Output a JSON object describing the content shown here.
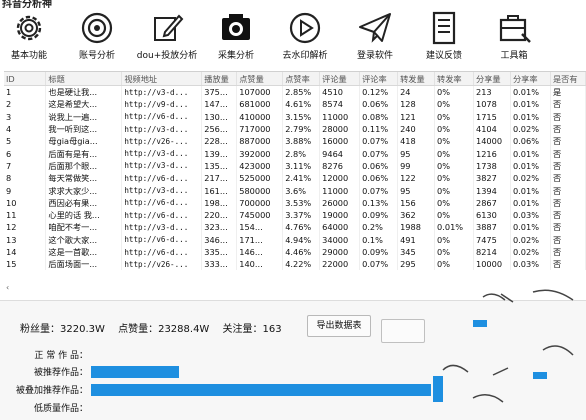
{
  "app": {
    "title": "抖音分析神"
  },
  "toolbar": [
    {
      "label": "基本功能",
      "icon": "gear-icon"
    },
    {
      "label": "账号分析",
      "icon": "target-icon"
    },
    {
      "label": "dou+投放分析",
      "icon": "pen-edit-icon"
    },
    {
      "label": "采集分析",
      "icon": "camera-icon"
    },
    {
      "label": "去水印解析",
      "icon": "play-circle-icon"
    },
    {
      "label": "登录软件",
      "icon": "paper-plane-icon"
    },
    {
      "label": "建议反馈",
      "icon": "document-icon"
    },
    {
      "label": "工具箱",
      "icon": "toolbox-icon"
    }
  ],
  "table": {
    "columns": [
      "ID",
      "标题",
      "视频地址",
      "播放量",
      "点赞量",
      "点赞率",
      "评论量",
      "评论率",
      "转发量",
      "转发率",
      "分享量",
      "分享率",
      "是否有"
    ],
    "rows": [
      [
        "1",
        "也是硬让我...",
        "http://v3-d...",
        "375...",
        "107000",
        "2.85%",
        "4510",
        "0.12%",
        "24",
        "0%",
        "213",
        "0.01%",
        "是"
      ],
      [
        "2",
        "这是希望大...",
        "http://v9-d...",
        "147...",
        "681000",
        "4.61%",
        "8574",
        "0.06%",
        "128",
        "0%",
        "1078",
        "0.01%",
        "否"
      ],
      [
        "3",
        "说我上一遍...",
        "http://v6-d...",
        "130...",
        "410000",
        "3.15%",
        "11000",
        "0.08%",
        "121",
        "0%",
        "1715",
        "0.01%",
        "否"
      ],
      [
        "4",
        "我一听到这...",
        "http://v3-d...",
        "256...",
        "717000",
        "2.79%",
        "28000",
        "0.11%",
        "240",
        "0%",
        "4104",
        "0.02%",
        "否"
      ],
      [
        "5",
        "母gia母gia...",
        "http://v26-...",
        "228...",
        "887000",
        "3.88%",
        "16000",
        "0.07%",
        "418",
        "0%",
        "14000",
        "0.06%",
        "否"
      ],
      [
        "6",
        "后面有是有...",
        "http://v3-d...",
        "139...",
        "392000",
        "2.8%",
        "9464",
        "0.07%",
        "95",
        "0%",
        "1216",
        "0.01%",
        "否"
      ],
      [
        "7",
        "后面那个眼...",
        "http://v3-d...",
        "135...",
        "423000",
        "3.11%",
        "8276",
        "0.06%",
        "99",
        "0%",
        "1738",
        "0.01%",
        "否"
      ],
      [
        "8",
        "每天常做笑...",
        "http://v6-d...",
        "217...",
        "525000",
        "2.41%",
        "12000",
        "0.06%",
        "122",
        "0%",
        "3827",
        "0.02%",
        "否"
      ],
      [
        "9",
        "求求大家少...",
        "http://v3-d...",
        "161...",
        "580000",
        "3.6%",
        "11000",
        "0.07%",
        "95",
        "0%",
        "1394",
        "0.01%",
        "否"
      ],
      [
        "10",
        "西因必有果...",
        "http://v6-d...",
        "198...",
        "700000",
        "3.53%",
        "26000",
        "0.13%",
        "156",
        "0%",
        "2867",
        "0.01%",
        "否"
      ],
      [
        "11",
        "心里的话 我...",
        "http://v6-d...",
        "220...",
        "745000",
        "3.37%",
        "19000",
        "0.09%",
        "362",
        "0%",
        "6130",
        "0.03%",
        "否"
      ],
      [
        "12",
        "咱配不考一...",
        "http://v3-d...",
        "323...",
        "154...",
        "4.76%",
        "64000",
        "0.2%",
        "1988",
        "0.01%",
        "3887",
        "0.01%",
        "否"
      ],
      [
        "13",
        "这个歌大家...",
        "http://v6-d...",
        "346...",
        "171...",
        "4.94%",
        "34000",
        "0.1%",
        "491",
        "0%",
        "7475",
        "0.02%",
        "否"
      ],
      [
        "14",
        "这是一首歌...",
        "http://v6-d...",
        "335...",
        "146...",
        "4.46%",
        "29000",
        "0.09%",
        "345",
        "0%",
        "8214",
        "0.02%",
        "否"
      ],
      [
        "15",
        "后面场面一...",
        "http://v26-...",
        "333...",
        "140...",
        "4.22%",
        "22000",
        "0.07%",
        "295",
        "0%",
        "10000",
        "0.03%",
        "否"
      ]
    ]
  },
  "summary": {
    "fans": "粉丝量：3220.3W",
    "likes": "点赞量：23288.4W",
    "follows": "关注量：163"
  },
  "export_button": "导出数据表",
  "progress": [
    {
      "label": "正 常 作 品：",
      "fraction": 0.0
    },
    {
      "label": "被推荐作品：",
      "fraction": 0.26
    },
    {
      "label": "被叠加推荐作品：",
      "fraction": 1.0
    },
    {
      "label": "低质量作品：",
      "fraction": 0.0
    }
  ],
  "colors": {
    "accent": "#1e8fe0"
  }
}
